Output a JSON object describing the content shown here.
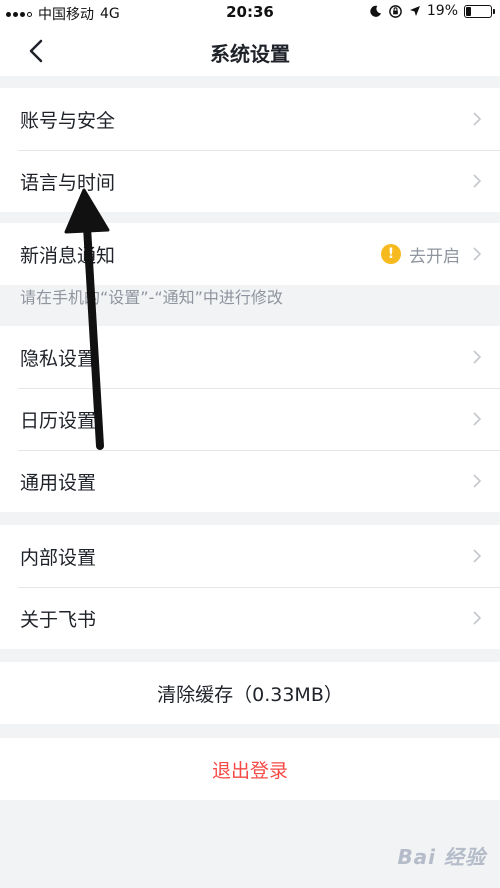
{
  "status_bar": {
    "carrier": "中国移动",
    "network": "4G",
    "time": "20:36",
    "battery": "19%",
    "battery_fraction": 0.19
  },
  "nav": {
    "title": "系统设置",
    "back_icon": "chevron-left-icon"
  },
  "groups": {
    "account": {
      "items": [
        {
          "label": "账号与安全"
        },
        {
          "label": "语言与时间"
        }
      ]
    },
    "notification": {
      "label": "新消息通知",
      "status": "去开启",
      "status_icon": "warning-icon",
      "status_color": "#f7ba1e",
      "hint": "请在手机的“设置”-“通知”中进行修改"
    },
    "settings": {
      "items": [
        {
          "label": "隐私设置"
        },
        {
          "label": "日历设置"
        },
        {
          "label": "通用设置"
        }
      ]
    },
    "about": {
      "items": [
        {
          "label": "内部设置"
        },
        {
          "label": "关于飞书"
        }
      ]
    }
  },
  "actions": {
    "clear_cache": "清除缓存（0.33MB）",
    "logout": "退出登录",
    "logout_color": "#f54a45"
  },
  "watermark": {
    "text": "Bai 经验"
  }
}
